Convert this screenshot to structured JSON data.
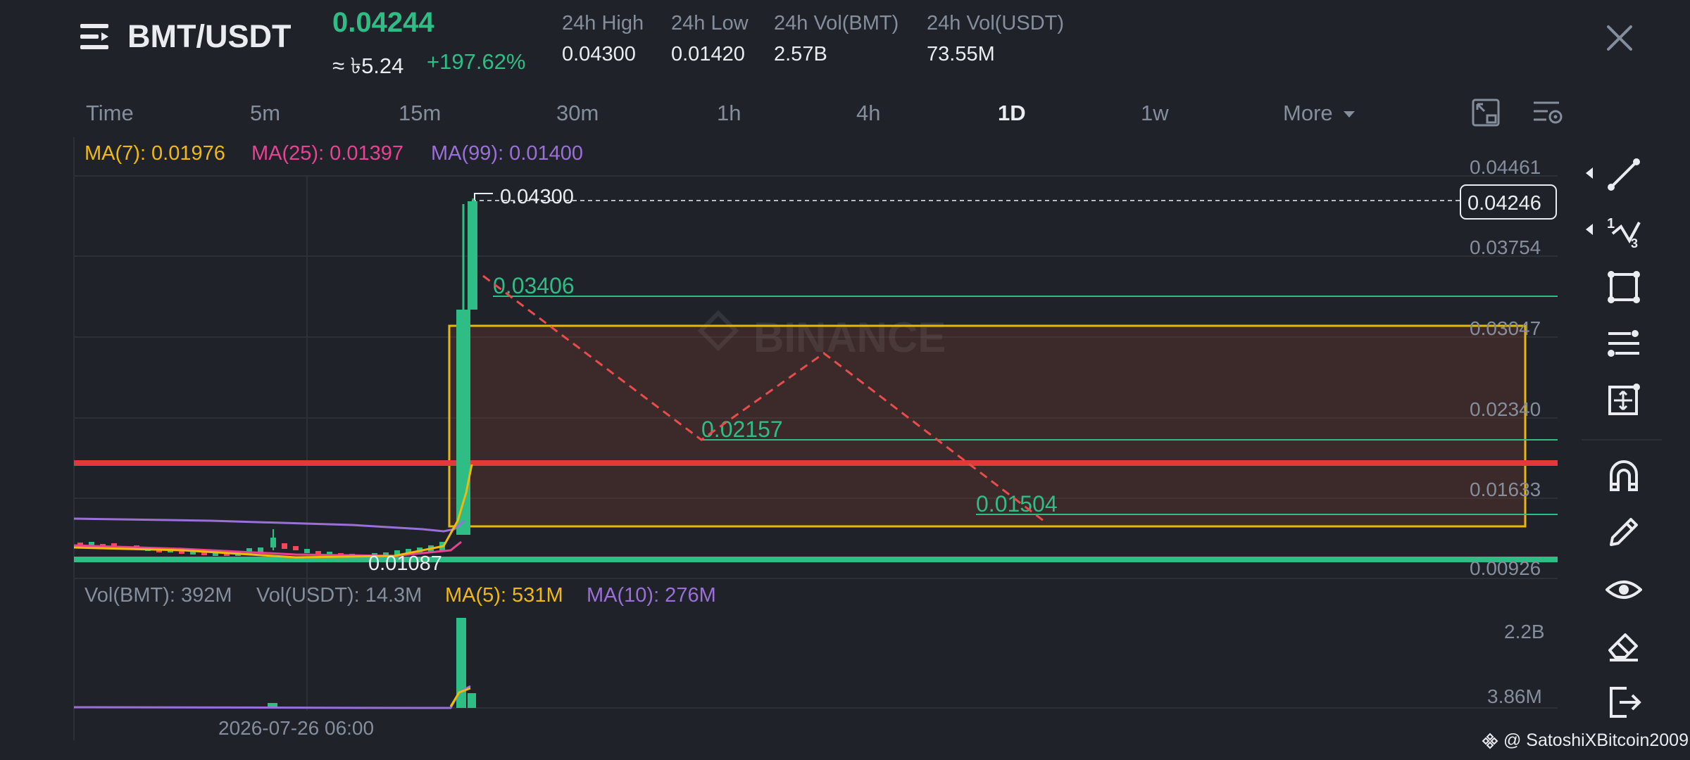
{
  "header": {
    "pair": "BMT/USDT",
    "last_price": "0.04244",
    "fiat_price": "≈ ৳5.24",
    "change_pct": "+197.62%",
    "stats": [
      {
        "label": "24h High",
        "value": "0.04300"
      },
      {
        "label": "24h Low",
        "value": "0.01420"
      },
      {
        "label": "24h Vol(BMT)",
        "value": "2.57B"
      },
      {
        "label": "24h Vol(USDT)",
        "value": "73.55M"
      }
    ]
  },
  "timeframes": {
    "items": [
      "Time",
      "5m",
      "15m",
      "30m",
      "1h",
      "4h",
      "1D",
      "1w"
    ],
    "active": "1D",
    "more_label": "More"
  },
  "indicators": {
    "ma7": "MA(7): 0.01976",
    "ma25": "MA(25): 0.01397",
    "ma99": "MA(99): 0.01400",
    "vol_bmt": "Vol(BMT): 392M",
    "vol_usdt": "Vol(USDT): 14.3M",
    "vol_ma5": "MA(5): 531M",
    "vol_ma10": "MA(10): 276M"
  },
  "chart": {
    "price_axis": [
      "0.04461",
      "0.03754",
      "0.03047",
      "0.02340",
      "0.01633",
      "0.00926"
    ],
    "volume_axis": [
      "2.2B",
      "3.86M"
    ],
    "current_price_label": "0.04246",
    "high_label": "0.04300",
    "low_label": "0.01087",
    "level_labels": [
      "0.03406",
      "0.02157",
      "0.01504"
    ],
    "x_axis_label": "2026-07-26 06:00",
    "watermark_text": "BINANCE"
  },
  "colors": {
    "up": "#2ebd85",
    "down": "#f6465d",
    "ma7": "#f0b90b",
    "ma25": "#e84393",
    "ma99": "#9b6fd8",
    "support_red": "#e03a3a",
    "rect_stroke": "#e5b80b",
    "trend_dash": "#e84c4c"
  },
  "icons": [
    "hamburger-icon",
    "close-icon",
    "fullscreen-icon",
    "chart-settings-icon",
    "trendline-icon",
    "fib-icon",
    "rectangle-icon",
    "alignment-icon",
    "measure-icon",
    "magnet-icon",
    "pencil-icon",
    "eye-icon",
    "eraser-icon",
    "exit-icon"
  ],
  "footer": {
    "credit": "@ SatoshiXBitcoin2009"
  }
}
